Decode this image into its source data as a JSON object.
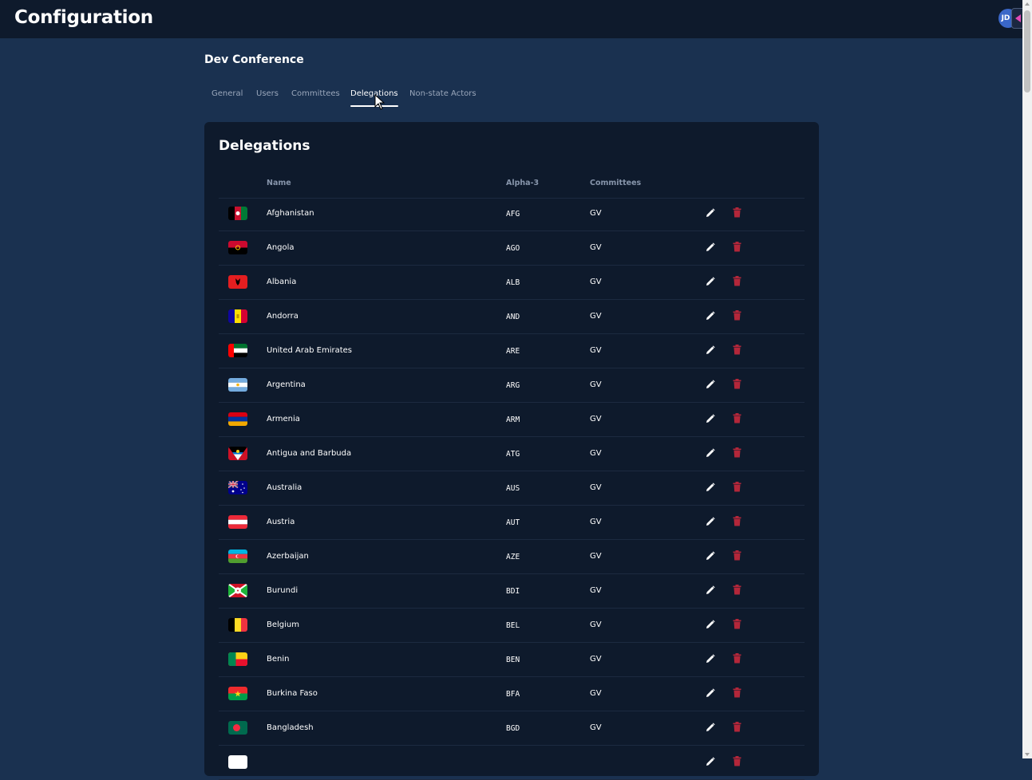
{
  "app": {
    "title": "Configuration",
    "avatar_initials": "JD"
  },
  "conference": {
    "name": "Dev Conference"
  },
  "tabs": [
    {
      "label": "General"
    },
    {
      "label": "Users"
    },
    {
      "label": "Committees"
    },
    {
      "label": "Delegations",
      "active": true
    },
    {
      "label": "Non-state Actors"
    }
  ],
  "delegations": {
    "title": "Delegations",
    "columns": {
      "name": "Name",
      "alpha3": "Alpha-3",
      "committees": "Committees"
    },
    "rows": [
      {
        "name": "Afghanistan",
        "alpha3": "AFG",
        "committees": "GV",
        "flag": "afg"
      },
      {
        "name": "Angola",
        "alpha3": "AGO",
        "committees": "GV",
        "flag": "ago"
      },
      {
        "name": "Albania",
        "alpha3": "ALB",
        "committees": "GV",
        "flag": "alb"
      },
      {
        "name": "Andorra",
        "alpha3": "AND",
        "committees": "GV",
        "flag": "and"
      },
      {
        "name": "United Arab Emirates",
        "alpha3": "ARE",
        "committees": "GV",
        "flag": "are"
      },
      {
        "name": "Argentina",
        "alpha3": "ARG",
        "committees": "GV",
        "flag": "arg"
      },
      {
        "name": "Armenia",
        "alpha3": "ARM",
        "committees": "GV",
        "flag": "arm"
      },
      {
        "name": "Antigua and Barbuda",
        "alpha3": "ATG",
        "committees": "GV",
        "flag": "atg"
      },
      {
        "name": "Australia",
        "alpha3": "AUS",
        "committees": "GV",
        "flag": "aus"
      },
      {
        "name": "Austria",
        "alpha3": "AUT",
        "committees": "GV",
        "flag": "aut"
      },
      {
        "name": "Azerbaijan",
        "alpha3": "AZE",
        "committees": "GV",
        "flag": "aze"
      },
      {
        "name": "Burundi",
        "alpha3": "BDI",
        "committees": "GV",
        "flag": "bdi"
      },
      {
        "name": "Belgium",
        "alpha3": "BEL",
        "committees": "GV",
        "flag": "bel"
      },
      {
        "name": "Benin",
        "alpha3": "BEN",
        "committees": "GV",
        "flag": "ben"
      },
      {
        "name": "Burkina Faso",
        "alpha3": "BFA",
        "committees": "GV",
        "flag": "bfa"
      },
      {
        "name": "Bangladesh",
        "alpha3": "BGD",
        "committees": "GV",
        "flag": "bgd"
      },
      {
        "name": "",
        "alpha3": "",
        "committees": "",
        "flag": "white"
      }
    ],
    "icons": {
      "edit": "pencil-icon",
      "delete": "trash-icon"
    }
  },
  "colors": {
    "background": "#1a3150",
    "card": "#0e1a2c",
    "delete": "#b3273a",
    "muted": "#8795ab"
  }
}
